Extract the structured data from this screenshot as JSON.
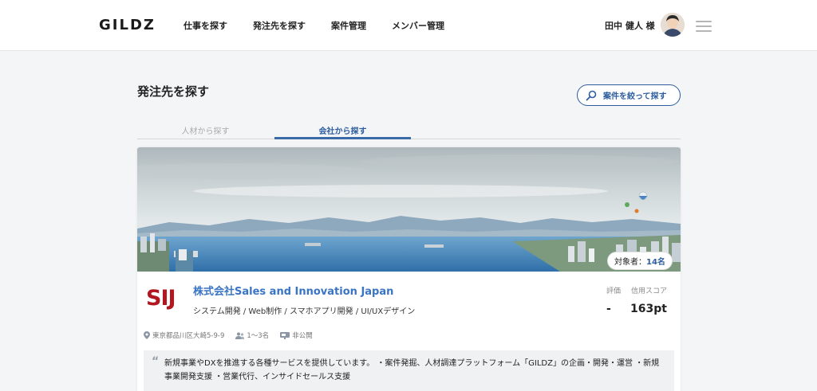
{
  "header": {
    "logo": "GILDZ",
    "nav": [
      "仕事を探す",
      "発注先を探す",
      "案件管理",
      "メンバー管理"
    ],
    "user_name": "田中 健人 様"
  },
  "page": {
    "title": "発注先を探す",
    "filter_button": "案件を絞って探す",
    "tabs": [
      "人材から探す",
      "会社から探す"
    ],
    "active_tab": "会社から探す"
  },
  "card": {
    "badge_label": "対象者：",
    "badge_count": "14名",
    "logo_text": "SIJ",
    "company_name": "株式会社Sales and Innovation Japan",
    "tags": "システム開発 / Web制作 / スマホアプリ開発 / UI/UXデザイン",
    "rating_label": "評価",
    "rating_value": "-",
    "credit_label": "信用スコア",
    "credit_value": "163pt",
    "address": "東京都品川区大崎5-9-9",
    "members": "1〜3名",
    "visibility": "非公開",
    "description": "新規事業やDXを推進する各種サービスを提供しています。 ・案件発掘、人材調達プラットフォーム「GILDZ」の企画・開発・運営 ・新規事業開発支援 ・営業代行、インサイドセールス支援",
    "colors": {
      "accent": "#3a74c4",
      "logo_red": "#b2171f"
    }
  }
}
